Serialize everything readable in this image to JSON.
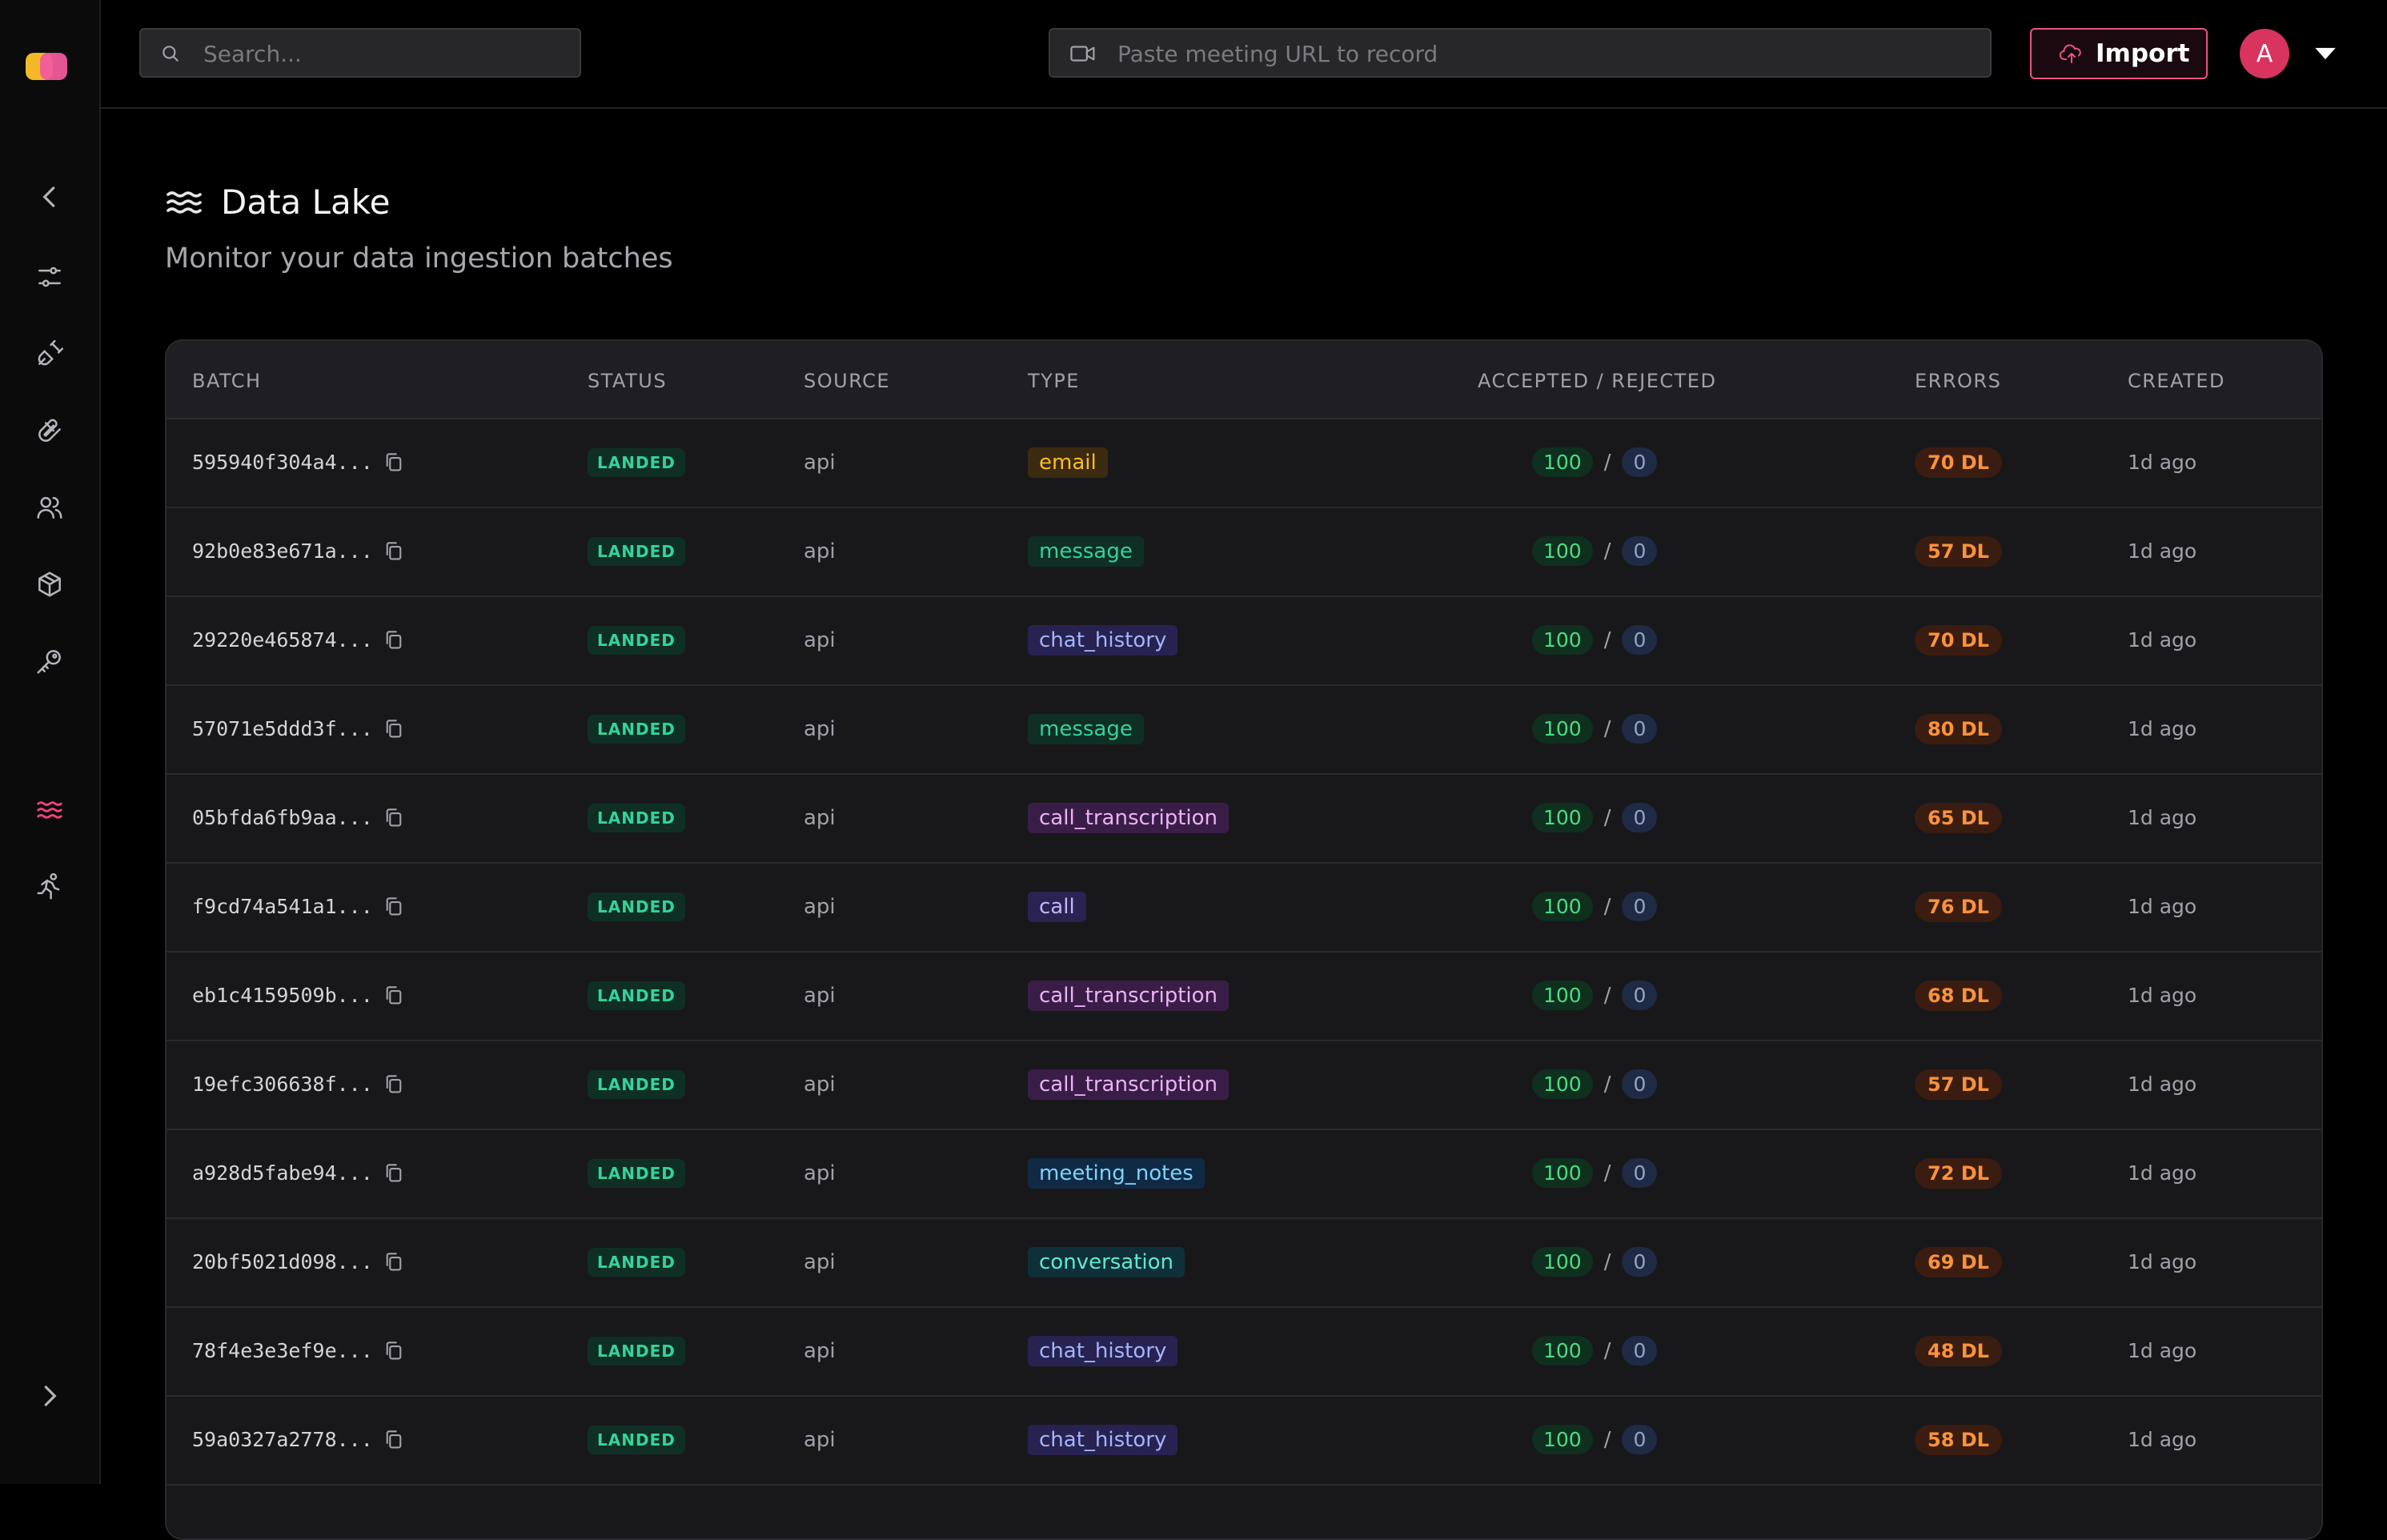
{
  "topbar": {
    "search_placeholder": "Search...",
    "meeting_placeholder": "Paste meeting URL to record",
    "import_label": "Import",
    "avatar_initial": "A"
  },
  "page": {
    "title": "Data Lake",
    "subtitle": "Monitor your data ingestion batches"
  },
  "table": {
    "headers": {
      "batch": "BATCH",
      "status": "STATUS",
      "source": "SOURCE",
      "type": "TYPE",
      "accepted_rejected": "ACCEPTED / REJECTED",
      "errors": "ERRORS",
      "created": "CREATED"
    },
    "rows": [
      {
        "batch": "595940f304a4...",
        "status": "LANDED",
        "source": "api",
        "type": "email",
        "accepted": "100",
        "rejected": "0",
        "errors": "70 DL",
        "created": "1d ago"
      },
      {
        "batch": "92b0e83e671a...",
        "status": "LANDED",
        "source": "api",
        "type": "message",
        "accepted": "100",
        "rejected": "0",
        "errors": "57 DL",
        "created": "1d ago"
      },
      {
        "batch": "29220e465874...",
        "status": "LANDED",
        "source": "api",
        "type": "chat_history",
        "accepted": "100",
        "rejected": "0",
        "errors": "70 DL",
        "created": "1d ago"
      },
      {
        "batch": "57071e5ddd3f...",
        "status": "LANDED",
        "source": "api",
        "type": "message",
        "accepted": "100",
        "rejected": "0",
        "errors": "80 DL",
        "created": "1d ago"
      },
      {
        "batch": "05bfda6fb9aa...",
        "status": "LANDED",
        "source": "api",
        "type": "call_transcription",
        "accepted": "100",
        "rejected": "0",
        "errors": "65 DL",
        "created": "1d ago"
      },
      {
        "batch": "f9cd74a541a1...",
        "status": "LANDED",
        "source": "api",
        "type": "call",
        "accepted": "100",
        "rejected": "0",
        "errors": "76 DL",
        "created": "1d ago"
      },
      {
        "batch": "eb1c4159509b...",
        "status": "LANDED",
        "source": "api",
        "type": "call_transcription",
        "accepted": "100",
        "rejected": "0",
        "errors": "68 DL",
        "created": "1d ago"
      },
      {
        "batch": "19efc306638f...",
        "status": "LANDED",
        "source": "api",
        "type": "call_transcription",
        "accepted": "100",
        "rejected": "0",
        "errors": "57 DL",
        "created": "1d ago"
      },
      {
        "batch": "a928d5fabe94...",
        "status": "LANDED",
        "source": "api",
        "type": "meeting_notes",
        "accepted": "100",
        "rejected": "0",
        "errors": "72 DL",
        "created": "1d ago"
      },
      {
        "batch": "20bf5021d098...",
        "status": "LANDED",
        "source": "api",
        "type": "conversation",
        "accepted": "100",
        "rejected": "0",
        "errors": "69 DL",
        "created": "1d ago"
      },
      {
        "batch": "78f4e3e3ef9e...",
        "status": "LANDED",
        "source": "api",
        "type": "chat_history",
        "accepted": "100",
        "rejected": "0",
        "errors": "48 DL",
        "created": "1d ago"
      },
      {
        "batch": "59a0327a2778...",
        "status": "LANDED",
        "source": "api",
        "type": "chat_history",
        "accepted": "100",
        "rejected": "0",
        "errors": "58 DL",
        "created": "1d ago"
      }
    ]
  },
  "type_colors": {
    "email": {
      "bg": "#3b2a10",
      "fg": "#fbbf24"
    },
    "message": {
      "bg": "#0f2f25",
      "fg": "#34d399"
    },
    "chat_history": {
      "bg": "#272250",
      "fg": "#a5b4fc"
    },
    "call_transcription": {
      "bg": "#3a1d47",
      "fg": "#e9b3f5"
    },
    "call": {
      "bg": "#2a2250",
      "fg": "#c4b5fd"
    },
    "meeting_notes": {
      "bg": "#102a45",
      "fg": "#7dd3fc"
    },
    "conversation": {
      "bg": "#0f3038",
      "fg": "#5eead4"
    }
  }
}
